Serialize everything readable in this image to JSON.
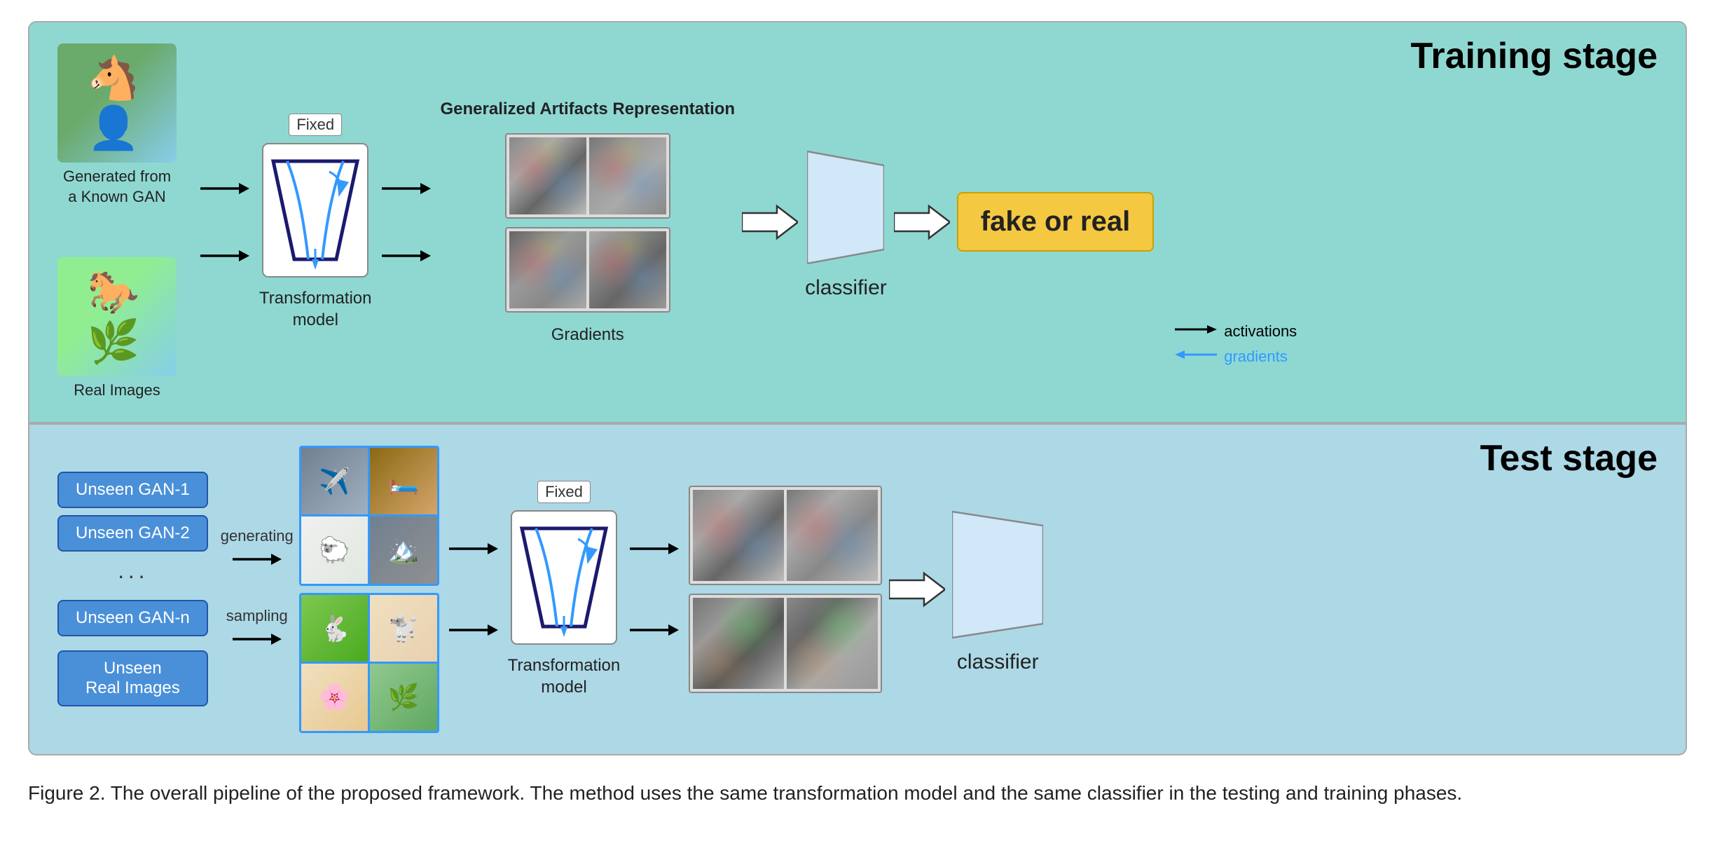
{
  "training_stage": {
    "title": "Training stage",
    "gar_label": "Generalized Artifacts Representation",
    "input": {
      "generated_label": "Generated from\na Known GAN",
      "real_label": "Real Images"
    },
    "transform": {
      "fixed_label": "Fixed",
      "model_label": "Transformation\nmodel"
    },
    "gradients_label": "Gradients",
    "classifier_label": "classifier",
    "output_label": "fake or real",
    "legend": {
      "activations_label": "activations",
      "gradients_label": "gradients"
    }
  },
  "test_stage": {
    "title": "Test stage",
    "gan_items": [
      "Unseen GAN-1",
      "Unseen GAN-2",
      "···",
      "Unseen GAN-n",
      "Unseen\nReal Images"
    ],
    "generating_label": "generating",
    "sampling_label": "sampling",
    "transform": {
      "fixed_label": "Fixed",
      "model_label": "Transformation\nmodel"
    },
    "classifier_label": "classifier"
  },
  "caption": "Figure 2. The overall pipeline of the proposed framework. The method uses the same transformation model and the same classifier in the\ntesting and training phases."
}
